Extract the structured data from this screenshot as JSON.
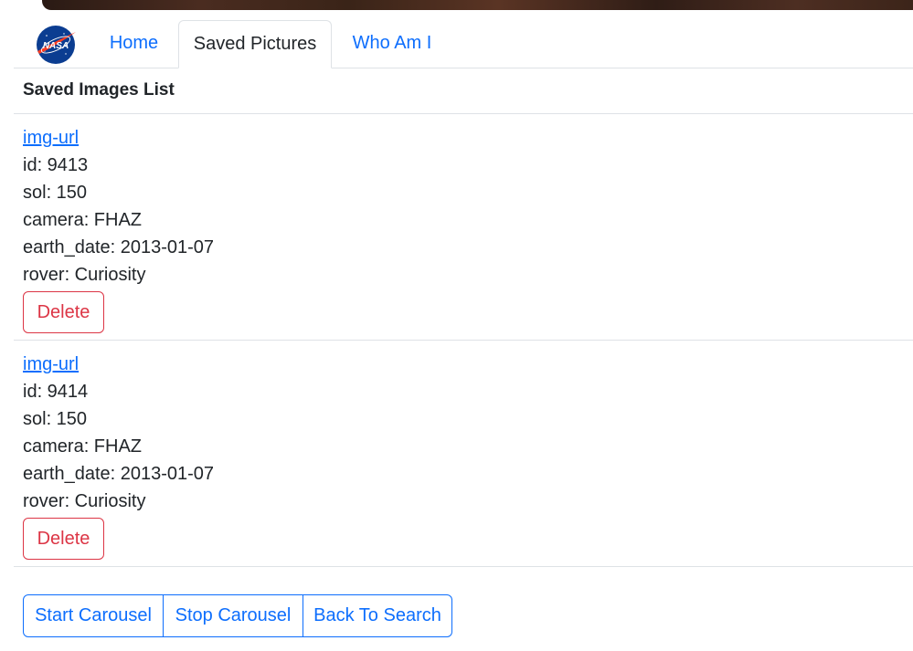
{
  "nav": {
    "logo_text": "NASA",
    "tabs": [
      {
        "label": "Home"
      },
      {
        "label": "Saved Pictures"
      },
      {
        "label": "Who Am I"
      }
    ],
    "active_tab": "Saved Pictures"
  },
  "list": {
    "title": "Saved Images List",
    "items": [
      {
        "link_label": "img-url",
        "id": "id: 9413",
        "sol": "sol: 150",
        "camera": "camera: FHAZ",
        "earth_date": "earth_date: 2013-01-07",
        "rover": "rover: Curiosity",
        "delete_label": "Delete"
      },
      {
        "link_label": "img-url",
        "id": "id: 9414",
        "sol": "sol: 150",
        "camera": "camera: FHAZ",
        "earth_date": "earth_date: 2013-01-07",
        "rover": "rover: Curiosity",
        "delete_label": "Delete"
      }
    ]
  },
  "controls": {
    "start_label": "Start Carousel",
    "stop_label": "Stop Carousel",
    "back_label": "Back To Search"
  },
  "colors": {
    "link": "#0d6efd",
    "danger": "#dc3545",
    "border": "#dee2e6",
    "nasa_blue": "#0b3d91",
    "nasa_red": "#fc3d21"
  }
}
